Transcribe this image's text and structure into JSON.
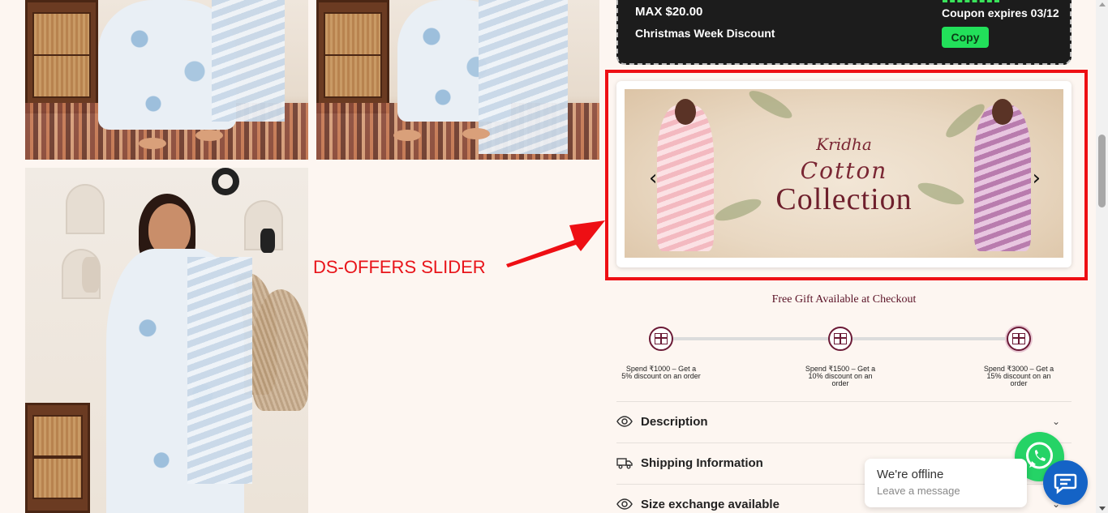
{
  "coupon": {
    "max_text": "MAX $20.00",
    "name": "Christmas Week Discount",
    "expiry": "Coupon expires 03/12",
    "copy_label": "Copy",
    "accent_color": "#22e05a"
  },
  "annotation": {
    "label": "DS-OFFERS SLIDER",
    "color": "#e8141a"
  },
  "offers_slider": {
    "brand": "Kridha",
    "script_text": "Cotton",
    "title": "Collection",
    "prev_label": "‹",
    "next_label": "›"
  },
  "free_gift": {
    "title": "Free Gift Available at Checkout",
    "tiers": [
      {
        "label": "Spend ₹1000 – Get a 5% discount on an order"
      },
      {
        "label": "Spend ₹1500 – Get a 10% discount on an order"
      },
      {
        "label": "Spend ₹3000 – Get a 15% discount on an order"
      }
    ],
    "accent_color": "#6b1a36"
  },
  "accordion": [
    {
      "label": "Description",
      "icon": "eye-icon"
    },
    {
      "label": "Shipping Information",
      "icon": "truck-icon"
    },
    {
      "label": "Size exchange available",
      "icon": "eye-icon"
    }
  ],
  "chat": {
    "offline_title": "We're offline",
    "offline_sub": "Leave a message",
    "whatsapp_color": "#25d366",
    "chat_color": "#1463c6"
  }
}
